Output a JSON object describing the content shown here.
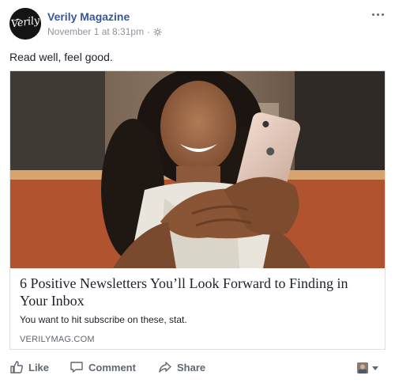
{
  "post": {
    "page_name": "Verily Magazine",
    "avatar_text": "Verily",
    "timestamp": "November 1 at 8:31pm",
    "separator": "·",
    "audience_icon": "globe-icon",
    "menu_icon": "more-options-icon",
    "message": "Read well, feel good."
  },
  "link": {
    "image_subject": "woman smiling while holding a phone",
    "title": "6 Positive Newsletters You’ll Look Forward to Finding in Your Inbox",
    "description": "You want to hit subscribe on these, stat.",
    "domain": "VERILYMAG.COM"
  },
  "actions": {
    "like_label": "Like",
    "comment_label": "Comment",
    "share_label": "Share",
    "like_icon": "thumbs-up-icon",
    "comment_icon": "speech-bubble-icon",
    "share_icon": "share-arrow-icon",
    "audience_selector_icon": "caret-down-icon"
  },
  "colors": {
    "link_blue": "#365899",
    "meta_gray": "#90949c",
    "action_gray": "#606770",
    "border": "#dddfe2"
  }
}
